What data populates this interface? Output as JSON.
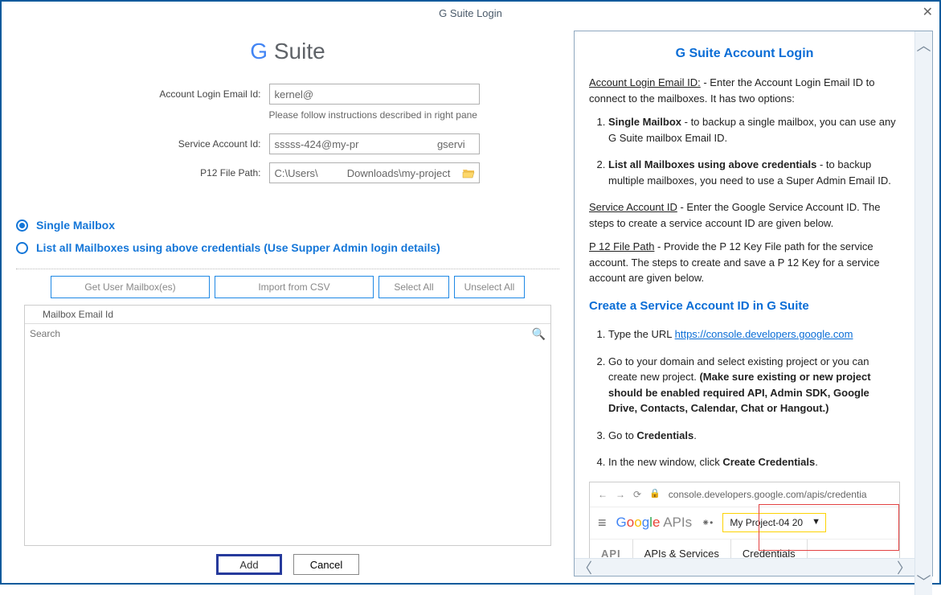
{
  "window": {
    "title": "G Suite Login"
  },
  "logo": {
    "text_left": "G",
    "text_right": "Suite"
  },
  "form": {
    "email_label": "Account Login Email Id:",
    "email_value": "kernel@",
    "email_hint": "Please follow instructions described in right pane",
    "service_label": "Service Account Id:",
    "service_value": "sssss-424@my-pr                           gservi",
    "p12_label": "P12 File Path:",
    "p12_value": "C:\\Users\\          Downloads\\my-project"
  },
  "radios": {
    "single": "Single Mailbox",
    "listall": "List all Mailboxes using above credentials (Use Supper Admin login details)"
  },
  "buttons": {
    "get": "Get User Mailbox(es)",
    "import": "Import from CSV",
    "selectall": "Select All",
    "unselectall": "Unselect All"
  },
  "mailbox": {
    "header": "Mailbox Email Id",
    "search_placeholder": "Search"
  },
  "bottom": {
    "add": "Add",
    "cancel": "Cancel"
  },
  "help": {
    "title": "G Suite Account Login",
    "intro_label": "Account Login Email ID:",
    "intro_text": " - Enter the Account Login Email ID to connect to the mailboxes. It has two options:",
    "opt1_label": "Single Mailbox",
    "opt1_text": " - to backup a single mailbox, you can use any G Suite mailbox Email ID.",
    "opt2_label": "List all Mailboxes using above credentials",
    "opt2_text": " - to backup multiple mailboxes, you need to use a Super Admin Email ID.",
    "svc_label": "Service Account ID",
    "svc_text": " - Enter the Google Service Account ID. The steps to create a service account ID are given below.",
    "p12_label": "P 12 File Path",
    "p12_text": " - Provide the P 12 Key File path for the service account. The steps to create and save a P 12 Key for a service account are given below.",
    "create_heading": "Create a Service Account ID in G Suite",
    "step1_pre": "Type the URL ",
    "step1_link": "https://console.developers.google.com",
    "step2a": "Go to your domain and select existing project or you can create new project. ",
    "step2b": "(Make sure existing or new project should be enabled required API, Admin SDK, Google Drive, Contacts, Calendar, Chat or Hangout.)",
    "step3_pre": "Go to ",
    "step3_bold": "Credentials",
    "step3_post": ".",
    "step4_pre": "In the new window, click ",
    "step4_bold": "Create Credentials",
    "step4_post": ".",
    "browser": {
      "url": "console.developers.google.com/apis/credentia",
      "project": "My Project-04         20",
      "api_label": "API",
      "apis_services": "APIs & Services",
      "credentials": "Credentials",
      "apis_word": " APIs"
    }
  }
}
